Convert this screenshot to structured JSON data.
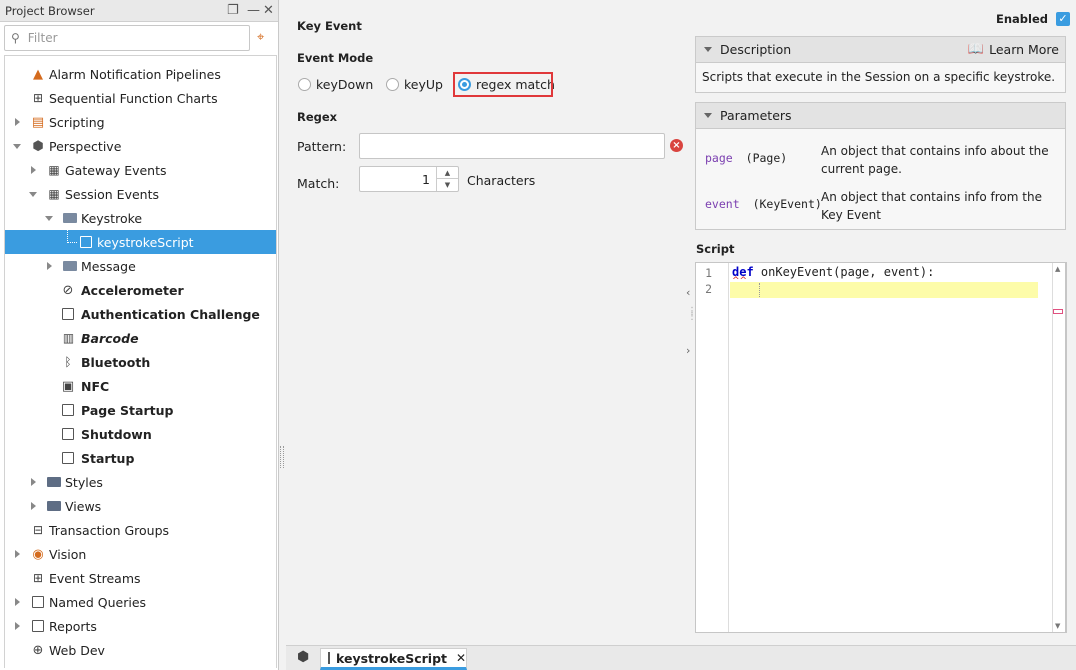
{
  "project_browser": {
    "title": "Project Browser",
    "filter_placeholder": "Filter",
    "items": [
      {
        "label": "Alarm Notification Pipelines"
      },
      {
        "label": "Sequential Function Charts"
      },
      {
        "label": "Scripting"
      },
      {
        "label": "Perspective"
      },
      {
        "label": "Gateway Events"
      },
      {
        "label": "Session Events"
      },
      {
        "label": "Keystroke"
      },
      {
        "label": "keystrokeScript"
      },
      {
        "label": "Message"
      },
      {
        "label": "Accelerometer"
      },
      {
        "label": "Authentication Challenge"
      },
      {
        "label": "Barcode"
      },
      {
        "label": "Bluetooth"
      },
      {
        "label": "NFC"
      },
      {
        "label": "Page Startup"
      },
      {
        "label": "Shutdown"
      },
      {
        "label": "Startup"
      },
      {
        "label": "Styles"
      },
      {
        "label": "Views"
      },
      {
        "label": "Transaction Groups"
      },
      {
        "label": "Vision"
      },
      {
        "label": "Event Streams"
      },
      {
        "label": "Named Queries"
      },
      {
        "label": "Reports"
      },
      {
        "label": "Web Dev"
      }
    ]
  },
  "editor": {
    "section_title": "Key Event",
    "enabled_label": "Enabled",
    "enabled_checked": true,
    "event_mode_label": "Event Mode",
    "modes": [
      "keyDown",
      "keyUp",
      "regex match"
    ],
    "selected_mode": "regex match",
    "regex_label": "Regex",
    "pattern_label": "Pattern:",
    "pattern_value": "",
    "match_label": "Match:",
    "match_value": "1",
    "characters_label": "Characters",
    "script_label": "Script"
  },
  "description": {
    "title": "Description",
    "learn_more": "Learn More",
    "text": "Scripts that execute in the Session on a specific keystroke."
  },
  "parameters": {
    "title": "Parameters",
    "items": [
      {
        "name": "page",
        "type": "(Page)",
        "desc1": "An object that contains info about the",
        "desc2": "current page."
      },
      {
        "name": "event",
        "type": "(KeyEvent)",
        "desc1": "An object that contains info from the",
        "desc2": "Key Event"
      }
    ]
  },
  "code": {
    "line_numbers": [
      "1",
      "2"
    ],
    "keyword": "def",
    "signature": " onKeyEvent(page, event):"
  },
  "bottom_tab": {
    "label": "keystrokeScript",
    "close": "✕"
  },
  "colors": {
    "accent": "#3a9ce0",
    "highlight_border": "#e0383a",
    "current_line": "#fdfca9",
    "param_name": "#7b3fb0"
  }
}
